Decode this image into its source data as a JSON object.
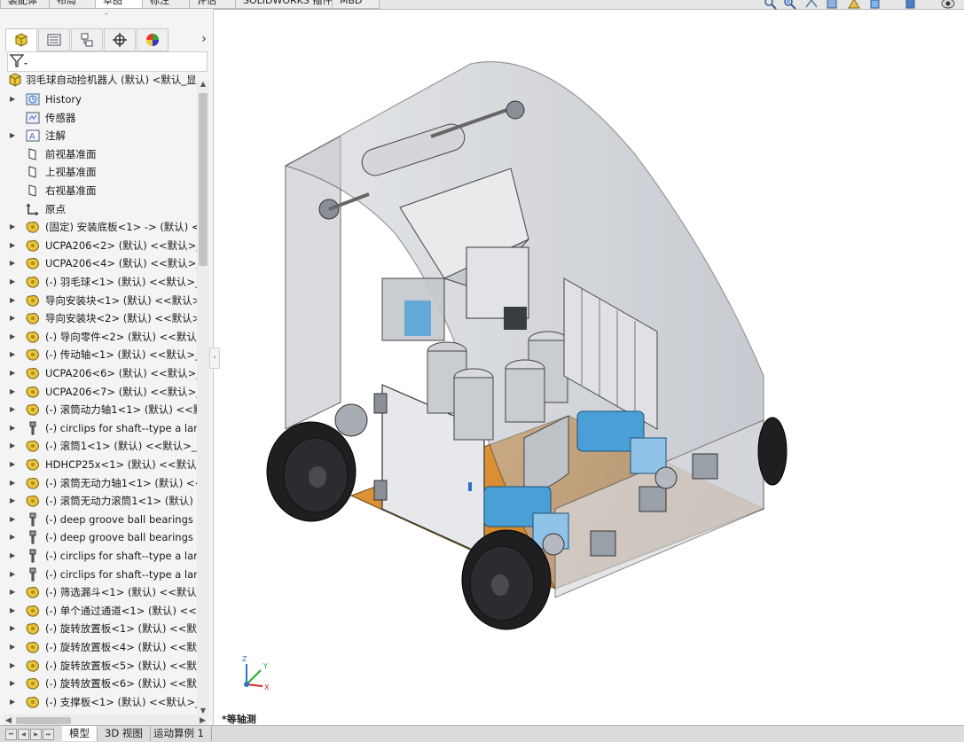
{
  "command_tabs": [
    "装配体",
    "布局",
    "草图",
    "标注",
    "评估",
    "SOLIDWORKS 插件",
    "MBD"
  ],
  "active_command_tab": 2,
  "panel_tabs": [
    {
      "name": "featuremanager-tree-icon"
    },
    {
      "name": "propertymanager-icon"
    },
    {
      "name": "configurationmanager-icon"
    },
    {
      "name": "dimxpert-icon"
    },
    {
      "name": "display-manager-icon"
    }
  ],
  "panel_more": "›",
  "panel_grip": "⌃",
  "tree": {
    "root": "羽毛球自动捡机器人 (默认) <默认_显示",
    "items": [
      {
        "label": "History",
        "icon": "history",
        "expand": true
      },
      {
        "label": "传感器",
        "icon": "sensor",
        "expand": false
      },
      {
        "label": "注解",
        "icon": "annotation",
        "expand": true
      },
      {
        "label": "前视基准面",
        "icon": "plane",
        "expand": false
      },
      {
        "label": "上视基准面",
        "icon": "plane",
        "expand": false
      },
      {
        "label": "右视基准面",
        "icon": "plane",
        "expand": false
      },
      {
        "label": "原点",
        "icon": "origin",
        "expand": false
      },
      {
        "label": "(固定) 安装底板<1> -> (默认) <<",
        "icon": "part",
        "expand": true
      },
      {
        "label": "UCPA206<2> (默认) <<默认>_显",
        "icon": "part",
        "expand": true
      },
      {
        "label": "UCPA206<4> (默认) <<默认>_显",
        "icon": "part",
        "expand": true
      },
      {
        "label": "(-) 羽毛球<1> (默认) <<默认>_显",
        "icon": "part",
        "expand": true
      },
      {
        "label": "导向安装块<1> (默认) <<默认>_",
        "icon": "part",
        "expand": true
      },
      {
        "label": "导向安装块<2> (默认) <<默认>_",
        "icon": "part",
        "expand": true
      },
      {
        "label": "(-) 导向零件<2> (默认) <<默认>_",
        "icon": "part",
        "expand": true
      },
      {
        "label": "(-) 传动轴<1> (默认) <<默认>_显",
        "icon": "part",
        "expand": true
      },
      {
        "label": "UCPA206<6> (默认) <<默认>_显",
        "icon": "part",
        "expand": true
      },
      {
        "label": "UCPA206<7> (默认) <<默认>_显",
        "icon": "part",
        "expand": true
      },
      {
        "label": "(-) 滚筒动力轴1<1> (默认) <<默i",
        "icon": "part",
        "expand": true
      },
      {
        "label": "(-) circlips for shaft--type a larg",
        "icon": "toolbox",
        "expand": true
      },
      {
        "label": "(-) 滚筒1<1> (默认) <<默认>_显",
        "icon": "part",
        "expand": true
      },
      {
        "label": "HDHCP25x<1> (默认) <<默认>_",
        "icon": "part",
        "expand": true
      },
      {
        "label": "(-) 滚筒无动力轴1<1> (默认) <<默",
        "icon": "part",
        "expand": true
      },
      {
        "label": "(-) 滚筒无动力滚筒1<1> (默认) <",
        "icon": "part",
        "expand": true
      },
      {
        "label": "(-) deep groove ball bearings g",
        "icon": "toolbox",
        "expand": true
      },
      {
        "label": "(-) deep groove ball bearings g",
        "icon": "toolbox",
        "expand": true
      },
      {
        "label": "(-) circlips for shaft--type a larg",
        "icon": "toolbox",
        "expand": true
      },
      {
        "label": "(-) circlips for shaft--type a larg",
        "icon": "toolbox",
        "expand": true
      },
      {
        "label": "(-) 筛选漏斗<1> (默认) <<默认>_",
        "icon": "part",
        "expand": true
      },
      {
        "label": "(-) 单个通过通道<1> (默认) <<默",
        "icon": "part",
        "expand": true
      },
      {
        "label": "(-) 旋转放置板<1> (默认) <<默认",
        "icon": "part",
        "expand": true
      },
      {
        "label": "(-) 旋转放置板<4> (默认) <<默认",
        "icon": "part",
        "expand": true
      },
      {
        "label": "(-) 旋转放置板<5> (默认) <<默认",
        "icon": "part",
        "expand": true
      },
      {
        "label": "(-) 旋转放置板<6> (默认) <<默认",
        "icon": "part",
        "expand": true
      },
      {
        "label": "(-) 支撑板<1> (默认) <<默认>_显",
        "icon": "part",
        "expand": true
      }
    ]
  },
  "bottom_tabs": [
    "模型",
    "3D 视图",
    "运动算例 1"
  ],
  "active_bottom_tab": 0,
  "view_label": "*等轴测",
  "triad": {
    "x": "X",
    "y": "Y",
    "z": "Z"
  },
  "colors": {
    "part_yellow": "#e8c53a",
    "accent_blue": "#2f6fd1",
    "floor_orange": "#d98a2b",
    "motor_blue": "#4aa0d6"
  }
}
